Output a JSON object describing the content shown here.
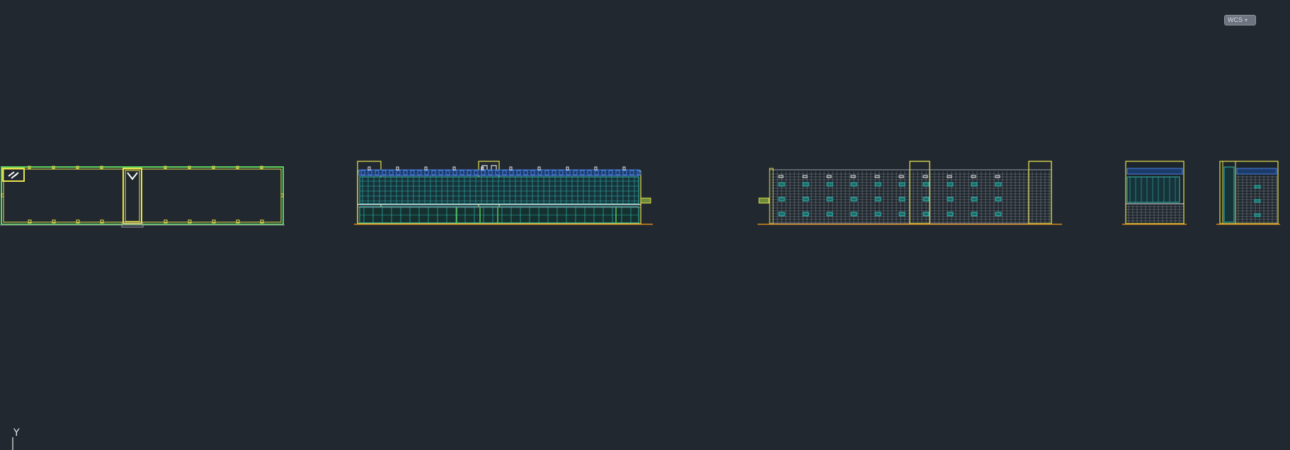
{
  "viewport": {
    "background": "#212830",
    "coordinate_system": {
      "label": "WCS",
      "dropdown_icon": "chevron-down-icon"
    },
    "ucs_icon": {
      "axis_label": "Y"
    }
  },
  "drawing": {
    "views": [
      {
        "kind": "floor-plan"
      },
      {
        "kind": "front-elevation"
      },
      {
        "kind": "rear-elevation"
      },
      {
        "kind": "side-elevation-left"
      },
      {
        "kind": "side-elevation-right"
      }
    ],
    "colors": {
      "yellow": "#e8e34a",
      "green": "#5fd35f",
      "cyan": "#2fb8b0",
      "blue": "#4a7fe0",
      "grey": "#9aa0a8",
      "white": "#e6e6e6",
      "orange": "#d98a1e"
    }
  }
}
